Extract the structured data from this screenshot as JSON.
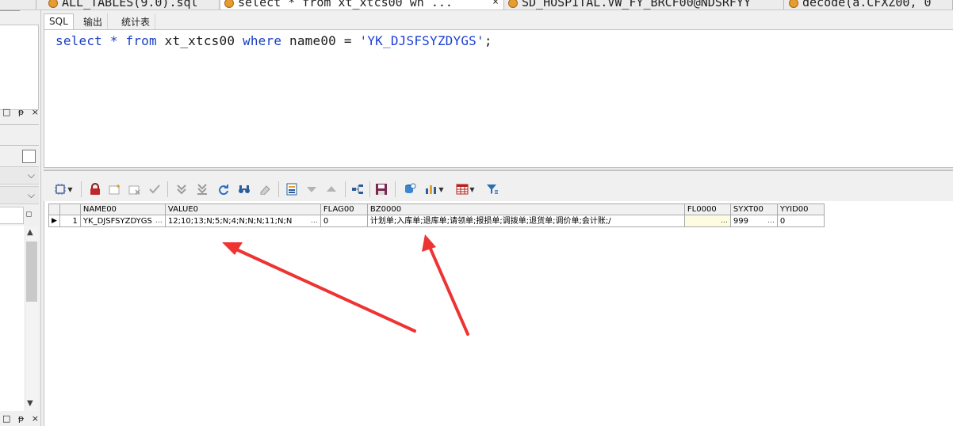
{
  "editor_tabs": [
    {
      "label": "ALL_TABLES(9.0).sql",
      "closable": false
    },
    {
      "label": "select * from xt_xtcs00 wh ...",
      "closable": true
    },
    {
      "label": "SD_HOSPITAL.VW_FY_BRCF00@NDSRFYY",
      "closable": false
    },
    {
      "label": "decode(a.CFXZ00, 0",
      "closable": false
    }
  ],
  "sub_tabs": [
    "SQL",
    "输出",
    "统计表"
  ],
  "sql": {
    "kw_select": "select",
    "star": " * ",
    "kw_from": "from",
    "table": " xt_xtcs00 ",
    "kw_where": "where",
    "condition": " name00 = ",
    "literal": "'YK_DJSFSYZDYGS'",
    "terminator": ";"
  },
  "left_panel": {
    "pin_controls": "□ ᵽ ×",
    "bottom_controls": "□ ᵽ ×"
  },
  "toolbar_icons": [
    "select-grid-icon",
    "lock-icon",
    "insert-record-icon",
    "delete-record-icon",
    "post-changes-icon",
    "next-page-icon",
    "last-page-icon",
    "refresh-icon",
    "query-by-example-icon",
    "clear-icon",
    "single-record-view-icon",
    "next-record-icon",
    "previous-record-icon",
    "export-query-icon",
    "save-icon",
    "fetch-icon",
    "chart-icon",
    "table-view-icon",
    "filter-icon"
  ],
  "result_grid": {
    "columns": [
      "NAME00",
      "VALUE0",
      "FLAG00",
      "BZ0000",
      "FL0000",
      "SYXT00",
      "YYID00"
    ],
    "rows": [
      {
        "row_number": "1",
        "cells": [
          "YK_DJSFSYZDYGS",
          "12;10;13;N;5;N;4;N;N;N;11;N;N",
          "0",
          "计划单;入库单;退库单;请领单;报损单;调拨单;退货单;调价单;会计账;/",
          "",
          "999",
          "0"
        ]
      }
    ]
  },
  "annotation_color": "#ee3333"
}
